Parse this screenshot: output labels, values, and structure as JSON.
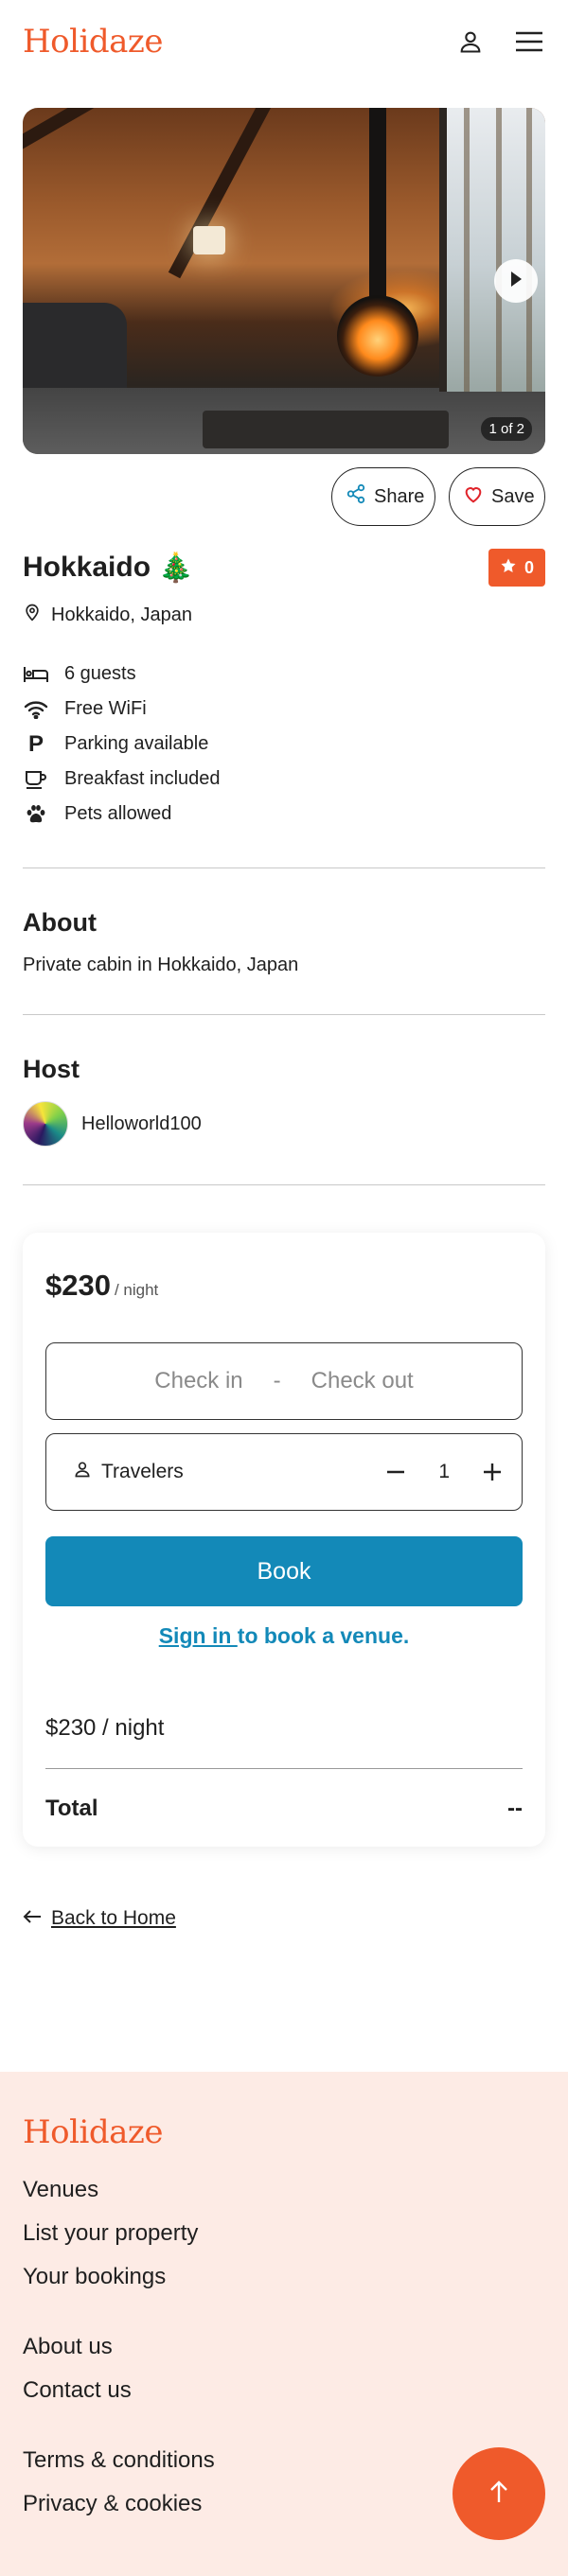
{
  "header": {
    "logo": "Holidaze",
    "profile_icon": "user-icon",
    "menu_icon": "hamburger-menu-icon"
  },
  "gallery": {
    "counter": "1 of 2",
    "next_icon": "chevron-right-icon"
  },
  "actions": {
    "share_label": "Share",
    "save_label": "Save"
  },
  "venue": {
    "name": "Hokkaido",
    "emoji": "🎄",
    "rating": "0",
    "location": "Hokkaido, Japan"
  },
  "amenities": [
    {
      "icon": "bed-icon",
      "label": "6 guests"
    },
    {
      "icon": "wifi-icon",
      "label": "Free WiFi"
    },
    {
      "icon": "parking-icon",
      "label": "Parking available"
    },
    {
      "icon": "coffee-cup-icon",
      "label": "Breakfast included"
    },
    {
      "icon": "paw-icon",
      "label": "Pets allowed"
    }
  ],
  "about": {
    "heading": "About",
    "text": "Private cabin in Hokkaido, Japan"
  },
  "host": {
    "heading": "Host",
    "name": "Helloworld100"
  },
  "booking": {
    "price": "$230",
    "unit": "/ night",
    "check_in": "Check in",
    "separator": "-",
    "check_out": "Check out",
    "travelers_label": "Travelers",
    "travelers_count": "1",
    "book_label": "Book",
    "signin_link": "Sign in ",
    "signin_suffix": "to book a venue.",
    "per_night_line": "$230 / night",
    "total_label": "Total",
    "total_value": "--"
  },
  "back": {
    "label": "Back to Home"
  },
  "footer": {
    "logo": "Holidaze",
    "group1": [
      "Venues",
      "List your property",
      "Your bookings"
    ],
    "group2": [
      "About us",
      "Contact us"
    ],
    "group3": [
      "Terms & conditions",
      "Privacy & cookies"
    ]
  },
  "colors": {
    "brand": "#ef5a2b",
    "primary": "#1389b8",
    "footer_bg": "#fdebe5"
  }
}
